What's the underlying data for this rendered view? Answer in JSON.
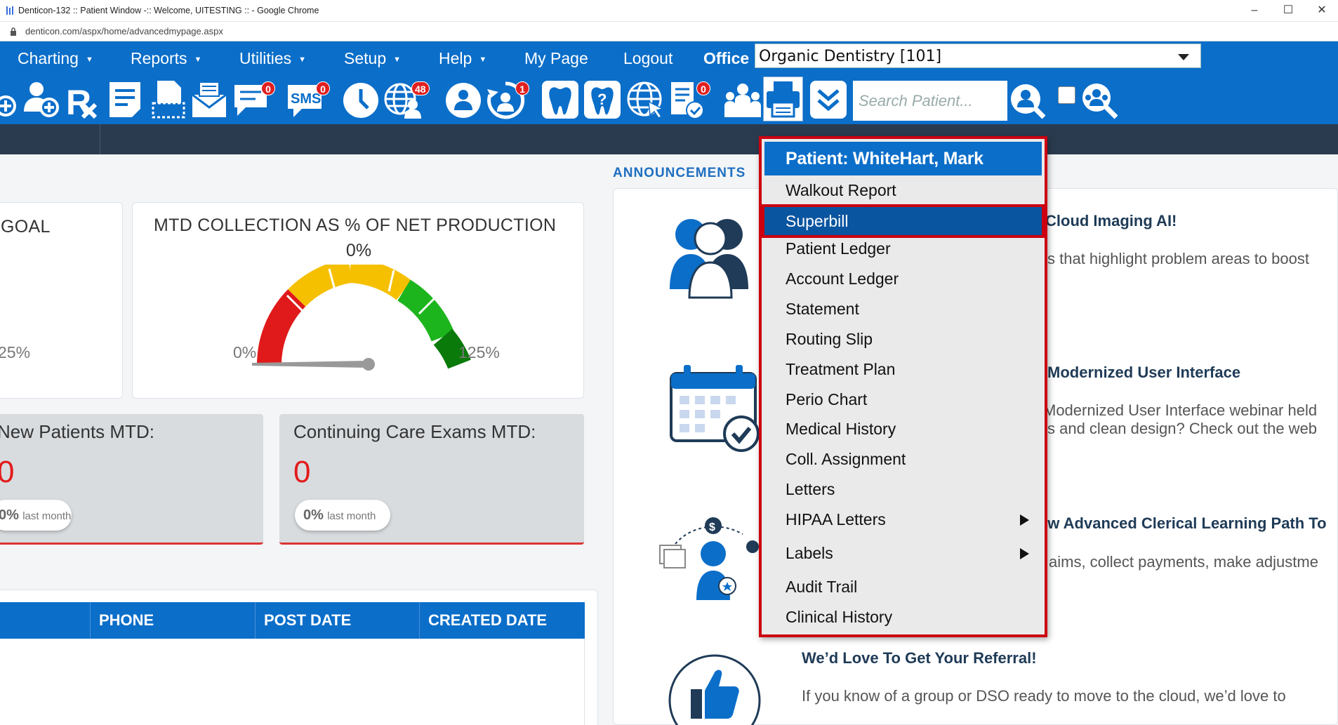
{
  "window": {
    "title": "Denticon-132 :: Patient Window -:: Welcome, UITESTING :: - Google Chrome",
    "url": "denticon.com/aspx/home/advancedmypage.aspx",
    "minimize": "–",
    "maximize": "☐",
    "close": "✕"
  },
  "menu": {
    "items": [
      {
        "label": "Charting",
        "caret": "▼"
      },
      {
        "label": "Reports",
        "caret": "▼"
      },
      {
        "label": "Utilities",
        "caret": "▼"
      },
      {
        "label": "Setup",
        "caret": "▼"
      },
      {
        "label": "Help",
        "caret": "▼"
      },
      {
        "label": "My Page"
      },
      {
        "label": "Logout"
      }
    ],
    "office_label": "Office",
    "office_value": "Organic Dentistry [101]"
  },
  "toolbar": {
    "sms_label": "SMS",
    "badges": {
      "messages": "0",
      "sms": "0",
      "online": "48",
      "recall": "1",
      "forms": "0"
    },
    "search_placeholder": "Search Patient..."
  },
  "dashboard": {
    "goal_card": {
      "title": "GOAL",
      "max_label": "25%"
    },
    "collection_card": {
      "title": "MTD COLLECTION AS % OF NET PRODUCTION",
      "value": "0%",
      "gauge_value": 0,
      "gauge_min": "0%",
      "gauge_max": "125%"
    },
    "new_patients": {
      "label": "New Patients MTD:",
      "value": "0",
      "pill_value": "0%",
      "pill_text": "last month"
    },
    "continuing_care": {
      "label": "Continuing Care Exams MTD:",
      "value": "0",
      "pill_value": "0%",
      "pill_text": "last month"
    },
    "table_headers": [
      "PHONE",
      "POST DATE",
      "CREATED DATE"
    ]
  },
  "announcements": {
    "label": "ANNOUNCEMENTS",
    "items": [
      {
        "title": "Cloud Imaging AI!",
        "text": "s that highlight problem areas to boost"
      },
      {
        "title": "Modernized User Interface",
        "text": "Modernized User Interface webinar held",
        "text2": "s and clean design? Check out the web"
      },
      {
        "title": "ew Advanced Clerical Learning Path To",
        "text": "aims, collect payments, make adjustme"
      },
      {
        "title": "We’d Love To Get Your Referral!",
        "text": "If you know of a group or DSO ready to move to the cloud, we’d love to"
      }
    ]
  },
  "dropdown": {
    "header": "Patient: WhiteHart, Mark",
    "items": [
      {
        "label": "Walkout Report"
      },
      {
        "label": "Superbill",
        "selected": true
      },
      {
        "label": "Patient Ledger"
      },
      {
        "label": "Account Ledger"
      },
      {
        "label": "Statement"
      },
      {
        "label": "Routing Slip"
      },
      {
        "label": "Treatment Plan"
      },
      {
        "label": "Perio Chart"
      },
      {
        "label": "Medical History"
      },
      {
        "label": "Coll. Assignment"
      },
      {
        "label": "Letters"
      },
      {
        "label": "HIPAA Letters",
        "submenu": true
      },
      {
        "label": "Labels",
        "submenu": true
      },
      {
        "label": "Audit Trail"
      },
      {
        "label": "Clinical History"
      }
    ]
  },
  "colors": {
    "primary": "#0b6ec9",
    "highlight_border": "#cc0010",
    "value_red": "#e31b1b",
    "dark_strip": "#2b3b4f"
  }
}
